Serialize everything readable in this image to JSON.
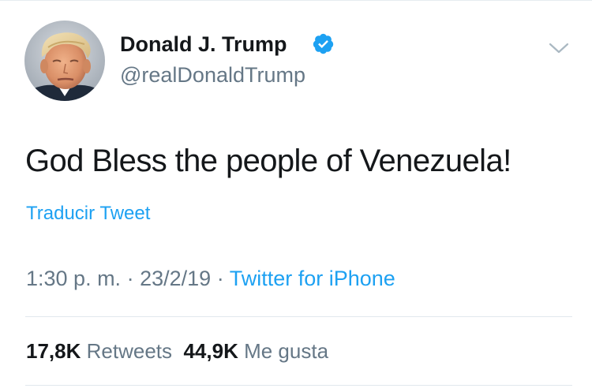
{
  "tweet": {
    "author": {
      "display_name": "Donald J. Trump",
      "handle": "@realDonaldTrump",
      "verified": true,
      "verified_icon": "verified-badge-icon",
      "avatar": "profile-photo"
    },
    "menu_icon": "chevron-down-icon",
    "text": "God Bless the people of Venezuela!",
    "translate_label": "Traducir Tweet",
    "time": "1:30 p. m.",
    "date": "23/2/19",
    "separator": "·",
    "source": "Twitter for iPhone",
    "stats": {
      "retweets_count": "17,8K",
      "retweets_label": "Retweets",
      "likes_count": "44,9K",
      "likes_label": "Me gusta"
    }
  },
  "colors": {
    "text": "#14171a",
    "secondary": "#657786",
    "link": "#1da1f2",
    "divider": "#e1e8ed",
    "background": "#ffffff"
  }
}
